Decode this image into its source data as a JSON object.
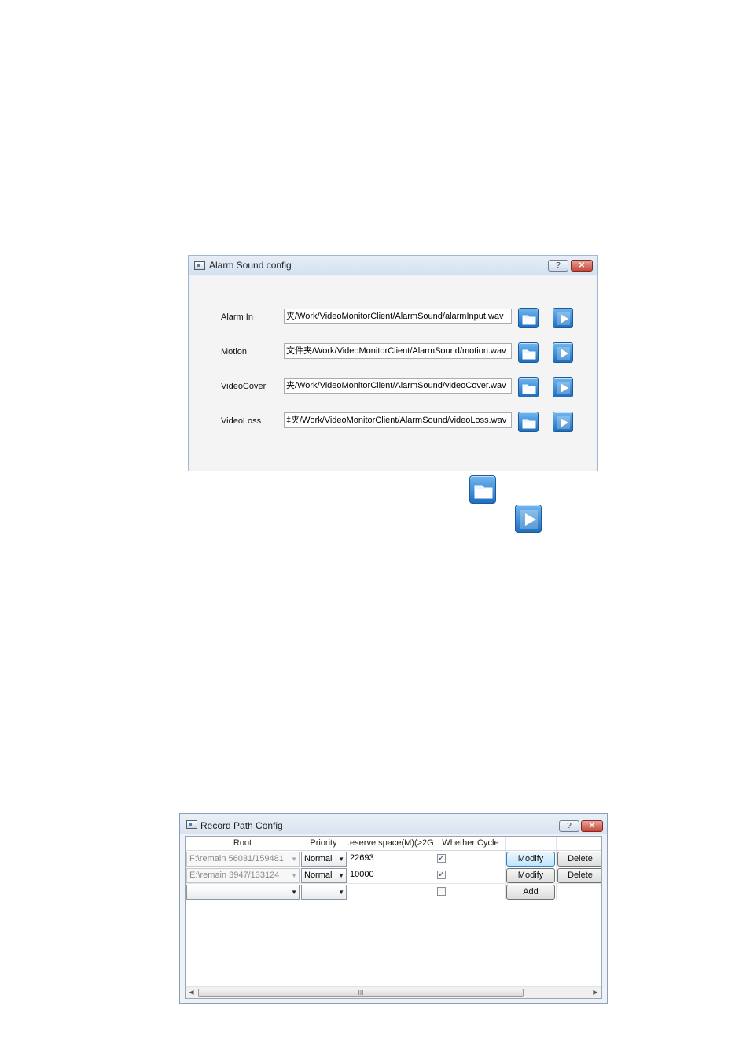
{
  "alarm_dialog": {
    "title": "Alarm Sound config",
    "help_label": "?",
    "close_label": "✕",
    "rows": [
      {
        "label": "Alarm In",
        "path": "夹/Work/VideoMonitorClient/AlarmSound/alarmInput.wav"
      },
      {
        "label": "Motion",
        "path": "文件夹/Work/VideoMonitorClient/AlarmSound/motion.wav"
      },
      {
        "label": "VideoCover",
        "path": "夹/Work/VideoMonitorClient/AlarmSound/videoCover.wav"
      },
      {
        "label": "VideoLoss",
        "path": "‡夹/Work/VideoMonitorClient/AlarmSound/videoLoss.wav"
      }
    ],
    "icons": {
      "browse": "folder-icon",
      "play": "play-icon"
    }
  },
  "record_dialog": {
    "title": "Record Path Config",
    "help_label": "?",
    "close_label": "✕",
    "columns": [
      "Root",
      "Priority",
      ".eserve space(M)(>2G",
      "Whether Cycle"
    ],
    "rows": [
      {
        "root": "F:\\remain 56031/159481",
        "priority": "Normal",
        "reserve": "22693",
        "cycle": true,
        "action1": "Modify",
        "action2": "Delete"
      },
      {
        "root": "E:\\remain 3947/133124",
        "priority": "Normal",
        "reserve": "10000",
        "cycle": true,
        "action1": "Modify",
        "action2": "Delete"
      },
      {
        "root": "",
        "priority": "",
        "reserve": "",
        "cycle": false,
        "action1": "Add",
        "action2": ""
      }
    ],
    "scrollbar_grip": "III"
  },
  "colors": {
    "accent_blue": "#1d6fc0",
    "window_border": "#9db9da",
    "close_red": "#c8463b"
  }
}
